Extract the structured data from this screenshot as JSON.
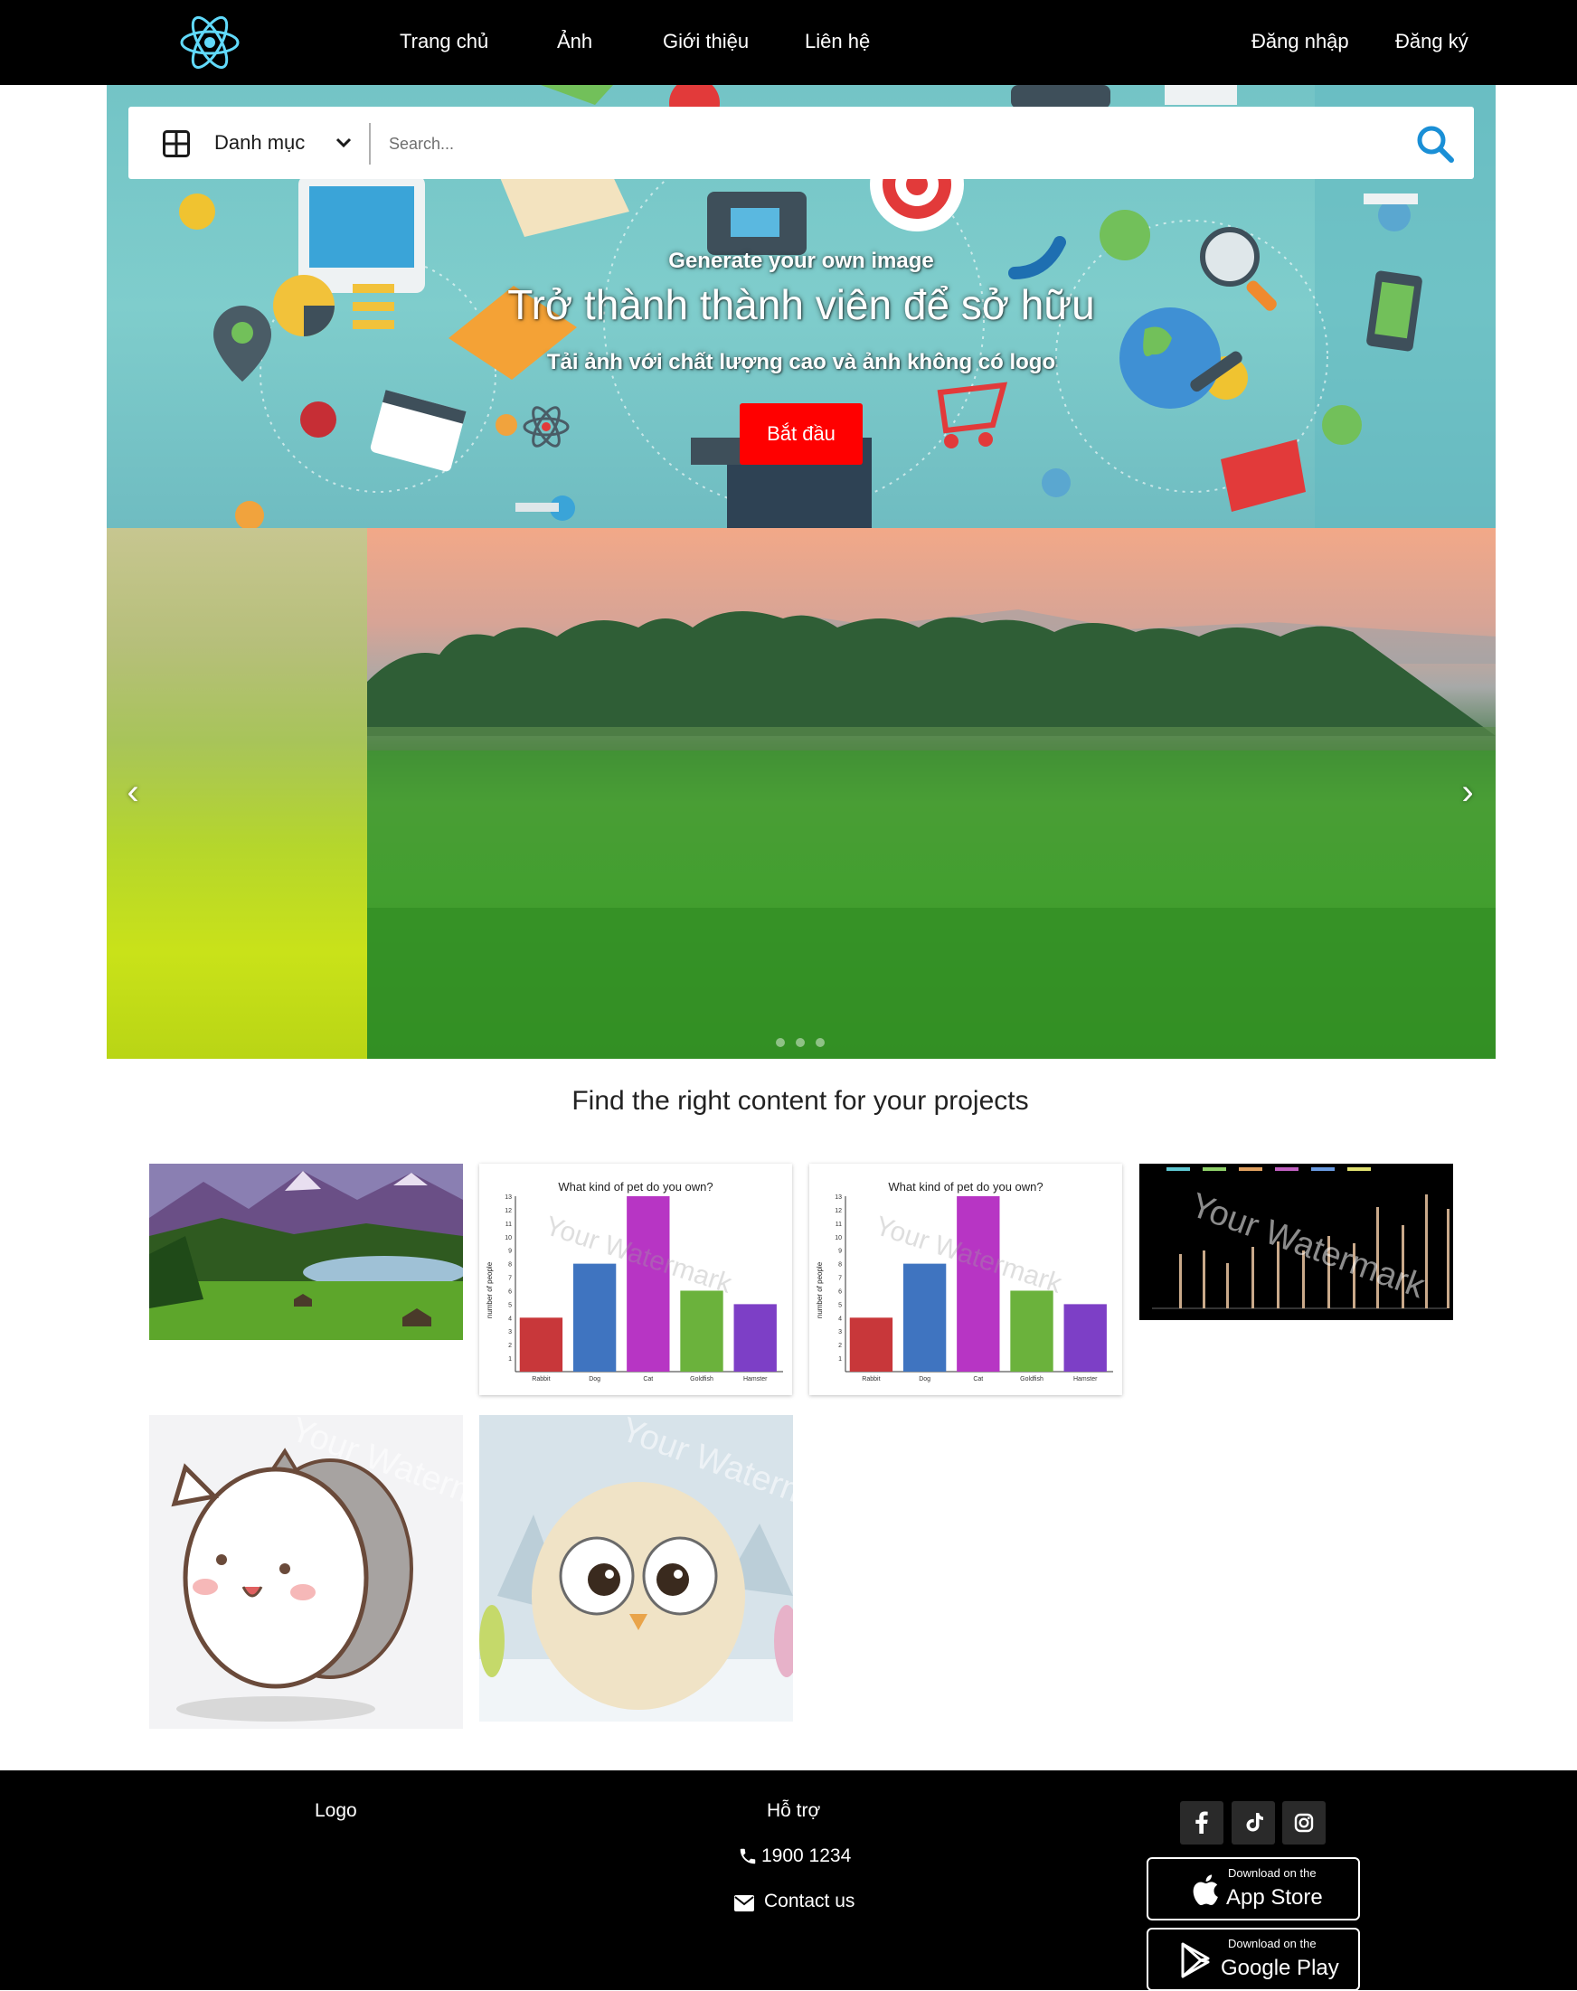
{
  "navbar": {
    "links": [
      "Trang chủ",
      "Ảnh",
      "Giới thiệu",
      "Liên hệ"
    ],
    "login": "Đăng nhập",
    "register": "Đăng ký"
  },
  "search": {
    "category_label": "Danh mục",
    "placeholder": "Search..."
  },
  "hero": {
    "kicker": "Generate your own image",
    "title": "Trở thành thành viên để sở hữu",
    "subtitle": "Tải ảnh với chất lượng cao và ảnh không có logo",
    "cta": "Bắt đầu"
  },
  "carousel": {
    "prev": "‹",
    "next": "›",
    "slide_count": 3
  },
  "section": {
    "title": "Find the right content for your projects"
  },
  "gallery": {
    "watermark": "Your Watermark",
    "pet_chart": {
      "title": "What kind of pet do you own?",
      "ylabel": "number of people",
      "categories": [
        "Rabbit",
        "Dog",
        "Cat",
        "Goldfish",
        "Hamster"
      ],
      "values": [
        4,
        8,
        13,
        6,
        5
      ],
      "ylim": [
        0,
        13
      ],
      "yticks": [
        "1",
        "2",
        "3",
        "4",
        "5",
        "6",
        "7",
        "8",
        "9",
        "10",
        "11",
        "12",
        "13"
      ],
      "colors": [
        "#c8373a",
        "#3f74c0",
        "#b735c4",
        "#6bb23c",
        "#7d3fc6"
      ]
    }
  },
  "footer": {
    "logo": "Logo",
    "support_title": "Hỗ trợ",
    "phone": "1900 1234",
    "contact": "Contact us",
    "app_store_small": "Download on the",
    "app_store_big": "App Store",
    "google_play_small": "Download on the",
    "google_play_big": "Google Play"
  },
  "colors": {
    "cta": "#ff0000",
    "navbar": "#000000",
    "search_icon": "#1a8fd6",
    "logo_icon": "#61dafb"
  },
  "icons": [
    "react-logo-icon",
    "grid-icon",
    "chevron-down-icon",
    "search-icon",
    "phone-icon",
    "envelope-icon",
    "facebook-icon",
    "tiktok-icon",
    "instagram-icon",
    "apple-icon",
    "google-play-icon"
  ]
}
